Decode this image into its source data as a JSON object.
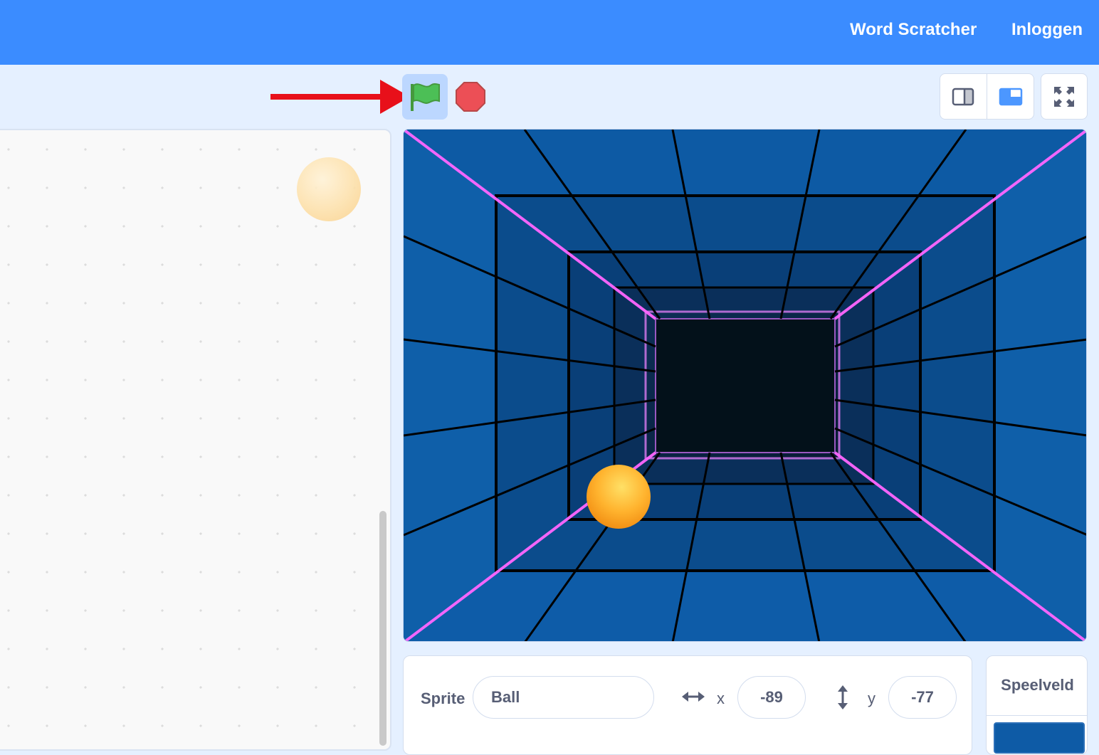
{
  "menubar": {
    "links": [
      "Word Scratcher",
      "Inloggen"
    ],
    "color": "#3b8cff"
  },
  "controls": {
    "flag_icon": "green-flag-icon",
    "stop_icon": "stop-icon",
    "annotation": "red-arrow-pointing-to-green-flag"
  },
  "stage_modes": {
    "small_icon": "small-stage-icon",
    "large_icon": "large-stage-icon",
    "fullscreen_icon": "fullscreen-icon"
  },
  "sprite_info": {
    "sprite_label": "Sprite",
    "sprite_name": "Ball",
    "x_label": "x",
    "x_value": "-89",
    "y_label": "y",
    "y_value": "-77",
    "x_icon": "horizontal-arrows-icon",
    "y_icon": "vertical-arrows-icon"
  },
  "stage_panel": {
    "title": "Speelveld"
  },
  "colors": {
    "accent": "#3b8cff",
    "stage_blue": "#0e5ba6",
    "neon_pink": "#ff66ff",
    "ball": "#ffb32e",
    "stop_red": "#ec4f56",
    "flag_green": "#4cbf56"
  }
}
